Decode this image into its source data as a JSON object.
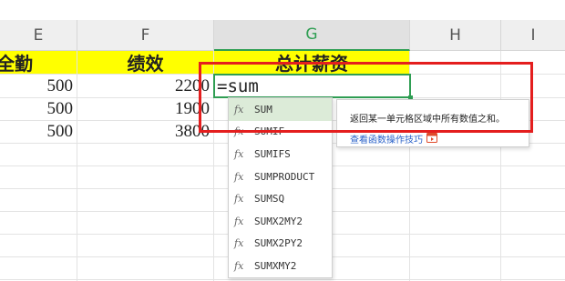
{
  "columns": [
    "E",
    "F",
    "G",
    "H",
    "I"
  ],
  "selected_column": "G",
  "header_row": {
    "e": "全勤",
    "f": "绩效",
    "g": "总计薪资"
  },
  "rows": [
    {
      "e": "500",
      "f": "2200"
    },
    {
      "e": "500",
      "f": "1900"
    },
    {
      "e": "500",
      "f": "3800"
    }
  ],
  "formula_input": "=sum",
  "autocomplete": {
    "items": [
      "SUM",
      "SUMIF",
      "SUMIFS",
      "SUMPRODUCT",
      "SUMSQ",
      "SUMX2MY2",
      "SUMX2PY2",
      "SUMXMY2"
    ],
    "selected_index": 0,
    "fx_glyph": "fx"
  },
  "tooltip": {
    "description": "返回某一单元格区域中所有数值之和。",
    "link": "查看函数操作技巧"
  },
  "colors": {
    "highlight_red": "#e41e1e",
    "accent_green": "#2f9e53",
    "header_yellow": "#ffff00"
  },
  "icons": {
    "tooltip_link_icon": "video-icon"
  }
}
